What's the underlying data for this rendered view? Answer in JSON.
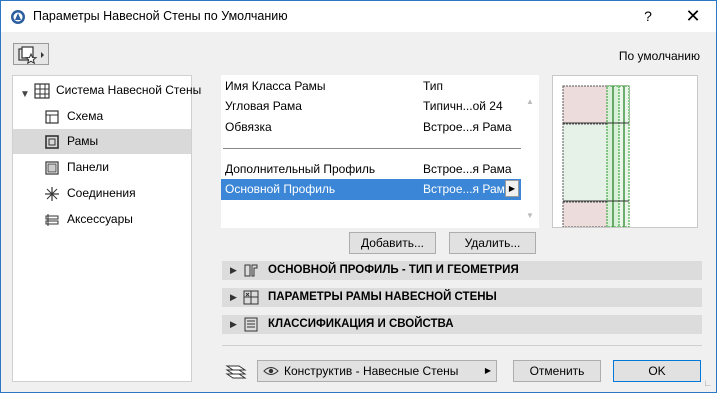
{
  "window": {
    "title": "Параметры Навесной Стены по Умолчанию",
    "help": "?",
    "close": "✕"
  },
  "toolbar": {
    "default_label": "По умолчанию"
  },
  "tree": {
    "root": "Система Навесной Стены",
    "items": [
      {
        "label": "Схема"
      },
      {
        "label": "Рамы"
      },
      {
        "label": "Панели"
      },
      {
        "label": "Соединения"
      },
      {
        "label": "Аксессуары"
      }
    ]
  },
  "list": {
    "rows": [
      {
        "name": "Имя Класса Рамы",
        "value": "Тип"
      },
      {
        "name": "Угловая Рама",
        "value": "Типичн...ой 24"
      },
      {
        "name": "Обвязка",
        "value": "Встрое...я Рама"
      },
      {
        "name": "Дополнительный Профиль",
        "value": "Встрое...я Рама"
      },
      {
        "name": "Основной Профиль",
        "value": "Встрое...я Рама"
      }
    ]
  },
  "buttons": {
    "add": "Добавить...",
    "delete": "Удалить...",
    "cancel": "Отменить",
    "ok": "OK"
  },
  "sections": [
    {
      "label": "ОСНОВНОЙ ПРОФИЛЬ - ТИП И ГЕОМЕТРИЯ"
    },
    {
      "label": "ПАРАМЕТРЫ РАМЫ НАВЕСНОЙ СТЕНЫ"
    },
    {
      "label": "КЛАССИФИКАЦИЯ И СВОЙСТВА"
    }
  ],
  "layer": {
    "value": "Конструктив - Навесные Стены"
  },
  "colors": {
    "selection": "#3b86d6",
    "tree_selection": "#d9d9d9",
    "section_bg": "#dcdcdc"
  }
}
